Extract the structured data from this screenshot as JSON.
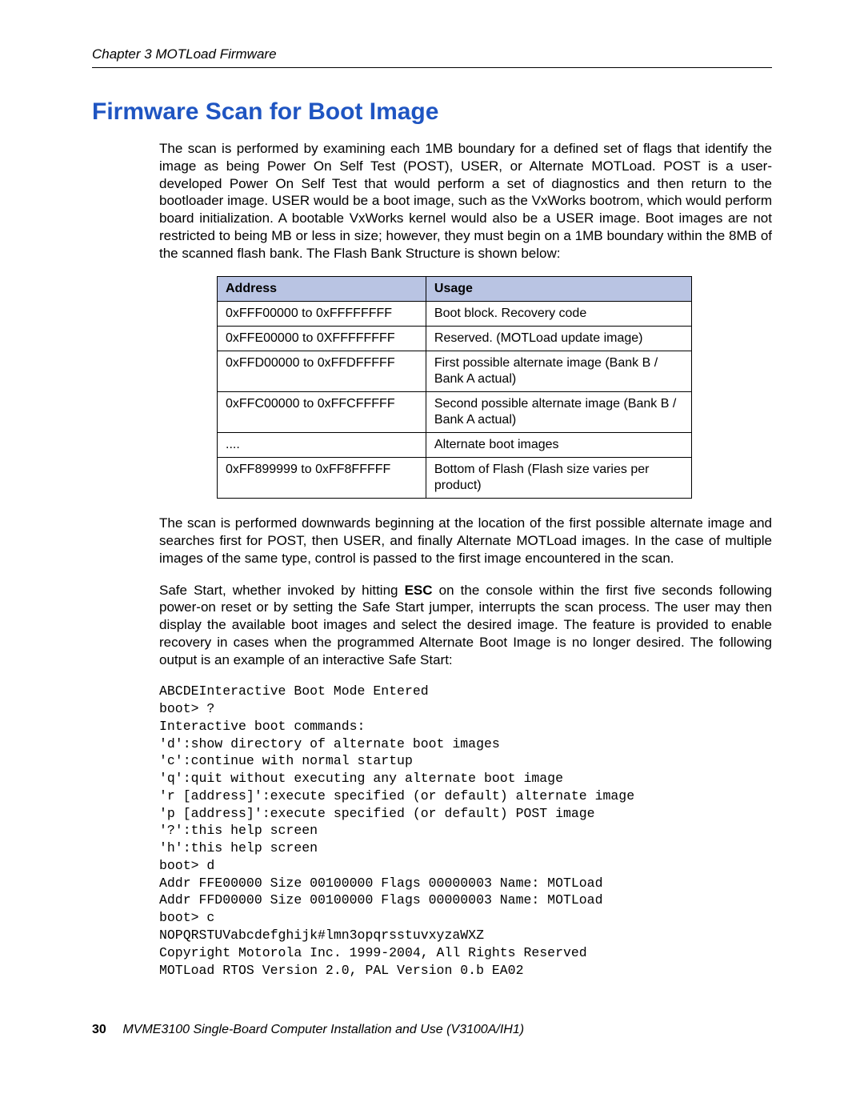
{
  "header": "Chapter 3  MOTLoad Firmware",
  "title": "Firmware Scan for Boot Image",
  "para1": "The scan is performed by examining each 1MB boundary for a defined set of flags that identify the image as being Power On Self Test (POST), USER, or Alternate MOTLoad. POST is a user-developed Power On Self Test that would perform a set of diagnostics and then return to the bootloader image. USER would be a boot image, such as the VxWorks bootrom, which would perform board initialization. A bootable VxWorks kernel would also be a USER image. Boot images are not restricted to being MB or less in size; however, they must begin on a 1MB boundary within the 8MB of the scanned flash bank. The Flash Bank Structure is shown below:",
  "table": {
    "headers": [
      "Address",
      "Usage"
    ],
    "rows": [
      [
        "0xFFF00000 to 0xFFFFFFFF",
        "Boot block. Recovery code"
      ],
      [
        "0xFFE00000 to 0XFFFFFFFF",
        "Reserved.\n(MOTLoad update image)"
      ],
      [
        "0xFFD00000 to 0xFFDFFFFF",
        "First possible alternate image\n(Bank B / Bank A actual)"
      ],
      [
        "0xFFC00000 to 0xFFCFFFFF",
        "Second possible alternate image\n(Bank B / Bank A actual)"
      ],
      [
        "....",
        "Alternate boot images"
      ],
      [
        "0xFF899999 to 0xFF8FFFFF",
        "Bottom of Flash\n(Flash size varies per product)"
      ]
    ]
  },
  "para2": "The scan is performed downwards beginning at the location of the first possible alternate image and searches first for POST, then USER, and finally Alternate MOTLoad images. In the case of multiple images of the same type, control is passed to the first image encountered in the scan.",
  "para3_pre": "Safe Start, whether invoked by hitting ",
  "para3_bold": "ESC",
  "para3_post": " on the console within the first five seconds following power-on reset or by setting the Safe Start jumper, interrupts the scan process. The user may then display the available boot images and select the desired image. The feature is provided to enable recovery in cases when the programmed Alternate Boot Image is no longer desired. The following output is an example of an interactive Safe Start:",
  "code": "ABCDEInteractive Boot Mode Entered\nboot> ?\nInteractive boot commands:\n'd':show directory of alternate boot images\n'c':continue with normal startup\n'q':quit without executing any alternate boot image\n'r [address]':execute specified (or default) alternate image\n'p [address]':execute specified (or default) POST image\n'?':this help screen\n'h':this help screen\nboot> d\nAddr FFE00000 Size 00100000 Flags 00000003 Name: MOTLoad\nAddr FFD00000 Size 00100000 Flags 00000003 Name: MOTLoad\nboot> c\nNOPQRSTUVabcdefghijk#lmn3opqrsstuvxyzaWXZ\nCopyright Motorola Inc. 1999-2004, All Rights Reserved\nMOTLoad RTOS Version 2.0, PAL Version 0.b EA02",
  "footer": {
    "page": "30",
    "text": "MVME3100 Single-Board Computer Installation and Use (V3100A/IH1)"
  }
}
